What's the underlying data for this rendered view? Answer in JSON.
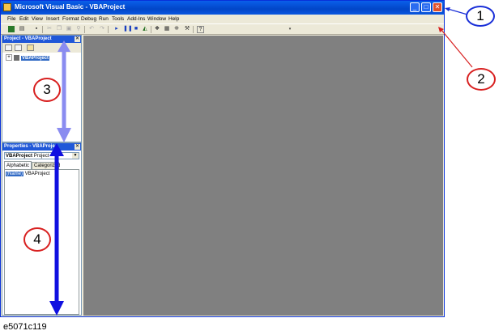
{
  "window": {
    "title": "Microsoft Visual Basic - VBAProject",
    "min_label": "_",
    "max_label": "□",
    "close_label": "✕"
  },
  "menu": [
    "File",
    "Edit",
    "View",
    "Insert",
    "Format",
    "Debug",
    "Run",
    "Tools",
    "Add-Ins",
    "Window",
    "Help"
  ],
  "project_panel": {
    "title": "Project - VBAProject",
    "tree_item": "VBAProject",
    "expand_label": "+"
  },
  "properties_panel": {
    "title": "Properties - VBAProje",
    "object_name": "VBAProject",
    "object_type": "Project",
    "tabs": [
      "Alphabetic",
      "Categorized"
    ],
    "row_name": "(Name)",
    "row_value": "VBAProject"
  },
  "callouts": [
    "1",
    "2",
    "3",
    "4"
  ],
  "caption": "e5071c119",
  "colors": {
    "blue_callout": "#1a2fd8",
    "red_callout": "#d82020",
    "arrow_light": "#8a8cf0",
    "arrow_dark": "#1010e0"
  }
}
